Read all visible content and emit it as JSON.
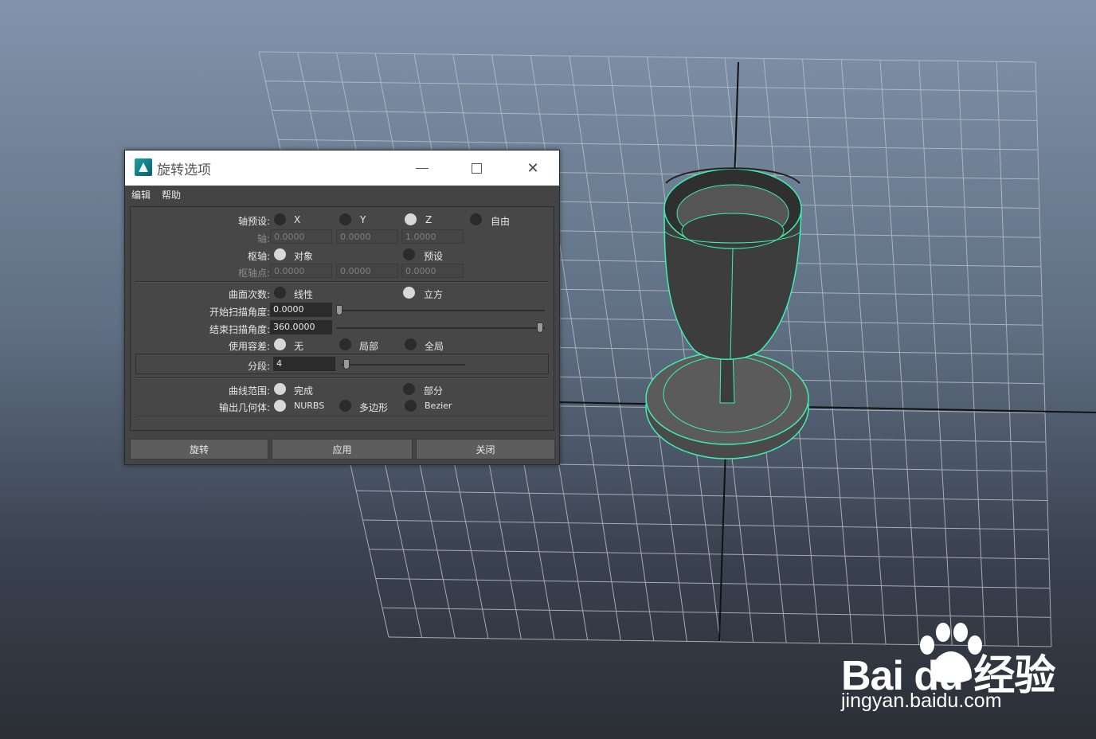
{
  "dialog": {
    "title": "旋转选项",
    "menu": [
      "编辑",
      "帮助"
    ],
    "axis_preset": {
      "label": "轴预设:",
      "options": [
        "X",
        "Y",
        "Z",
        "自由"
      ],
      "selected": "Z"
    },
    "axis": {
      "label": "轴:",
      "values": [
        "0.0000",
        "0.0000",
        "1.0000"
      ]
    },
    "pivot": {
      "label": "枢轴:",
      "options": [
        "对象",
        "预设"
      ],
      "selected": "对象"
    },
    "pivot_point": {
      "label": "枢轴点:",
      "values": [
        "0.0000",
        "0.0000",
        "0.0000"
      ]
    },
    "surface_degree": {
      "label": "曲面次数:",
      "options": [
        "线性",
        "立方"
      ],
      "selected": "立方"
    },
    "start_sweep": {
      "label": "开始扫描角度:",
      "value": "0.0000",
      "slider_fraction": 0.0
    },
    "end_sweep": {
      "label": "结束扫描角度:",
      "value": "360.0000",
      "slider_fraction": 1.0
    },
    "use_tolerance": {
      "label": "使用容差:",
      "options": [
        "无",
        "局部",
        "全局"
      ],
      "selected": "无"
    },
    "segments": {
      "label": "分段:",
      "value": "4",
      "slider_fraction": 0.04
    },
    "curve_range": {
      "label": "曲线范围:",
      "options": [
        "完成",
        "部分"
      ],
      "selected": "完成"
    },
    "output_geometry": {
      "label": "输出几何体:",
      "options": [
        "NURBS",
        "多边形",
        "Bezier"
      ],
      "selected": "NURBS"
    },
    "buttons": {
      "revolve": "旋转",
      "apply": "应用",
      "close": "关闭"
    }
  },
  "watermark": {
    "brand": "Bai  du 经验",
    "url": "jingyan.baidu.com"
  },
  "colors": {
    "wireframe": "#3ef0b0",
    "grid": "#b9bec6",
    "dialog_bg": "#444444"
  }
}
